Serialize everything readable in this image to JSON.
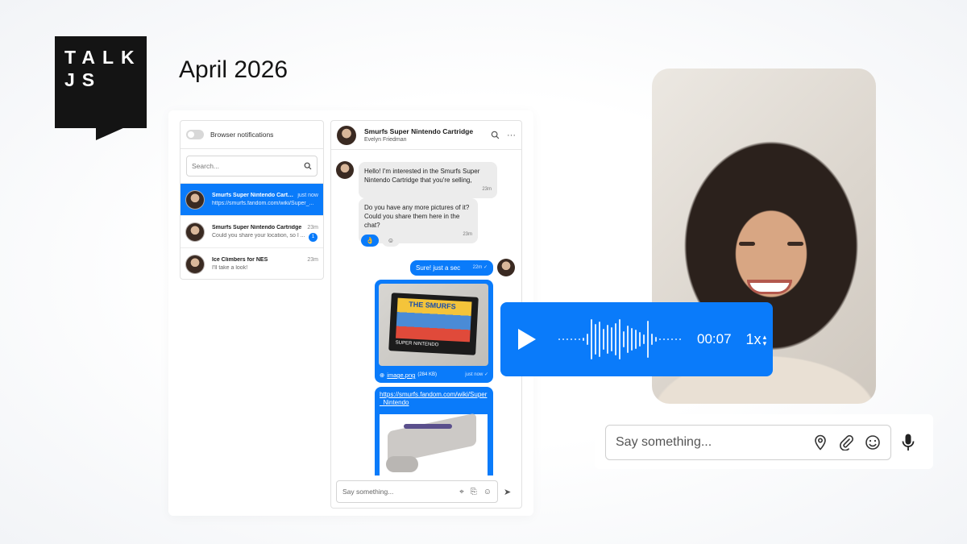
{
  "brand": {
    "logo_line1": "TALK",
    "logo_line2": "JS"
  },
  "page_title": "April 2026",
  "inbox": {
    "notifications_label": "Browser notifications",
    "search_placeholder": "Search...",
    "conversations": [
      {
        "title": "Smurfs Super Nintendo Cartri...",
        "time": "just now",
        "preview": "https://smurfs.fandom.com/wiki/Super_...",
        "unread": ""
      },
      {
        "title": "Smurfs Super Nintendo Cartridge",
        "time": "23m",
        "preview": "Could you share your location, so I ...",
        "unread": "1"
      },
      {
        "title": "Ice Climbers for NES",
        "time": "23m",
        "preview": "I'll take a look!",
        "unread": ""
      }
    ]
  },
  "chat": {
    "title": "Smurfs Super Nintendo Cartridge",
    "subtitle": "Evelyn Friedman",
    "messages": {
      "m1_text": "Hello! I'm interested in the Smurfs Super Nintendo Cartridge that you're selling,",
      "m1_time": "23m",
      "m2_text": "Do you have any more pictures of it? Could you share them here in the chat?",
      "m2_time": "23m",
      "reaction_1": "👌",
      "reaction_2": "☺",
      "m3_text": "Sure! just a sec",
      "m3_time": "22m ✓",
      "attachment_name": "image.png",
      "attachment_size": "(284 KB)",
      "attachment_time": "just now ✓",
      "art_title": "THE SMURFS",
      "art_platform": "SUPER NINTENDO",
      "link_text": "https://smurfs.fandom.com/wiki/Super_Nintendo"
    },
    "composer_placeholder": "Say something..."
  },
  "voice_note": {
    "duration": "00:07",
    "speed": "1x"
  },
  "big_composer": {
    "placeholder": "Say something..."
  },
  "colors": {
    "accent": "#0a7bfa",
    "logo_bg": "#141414"
  }
}
